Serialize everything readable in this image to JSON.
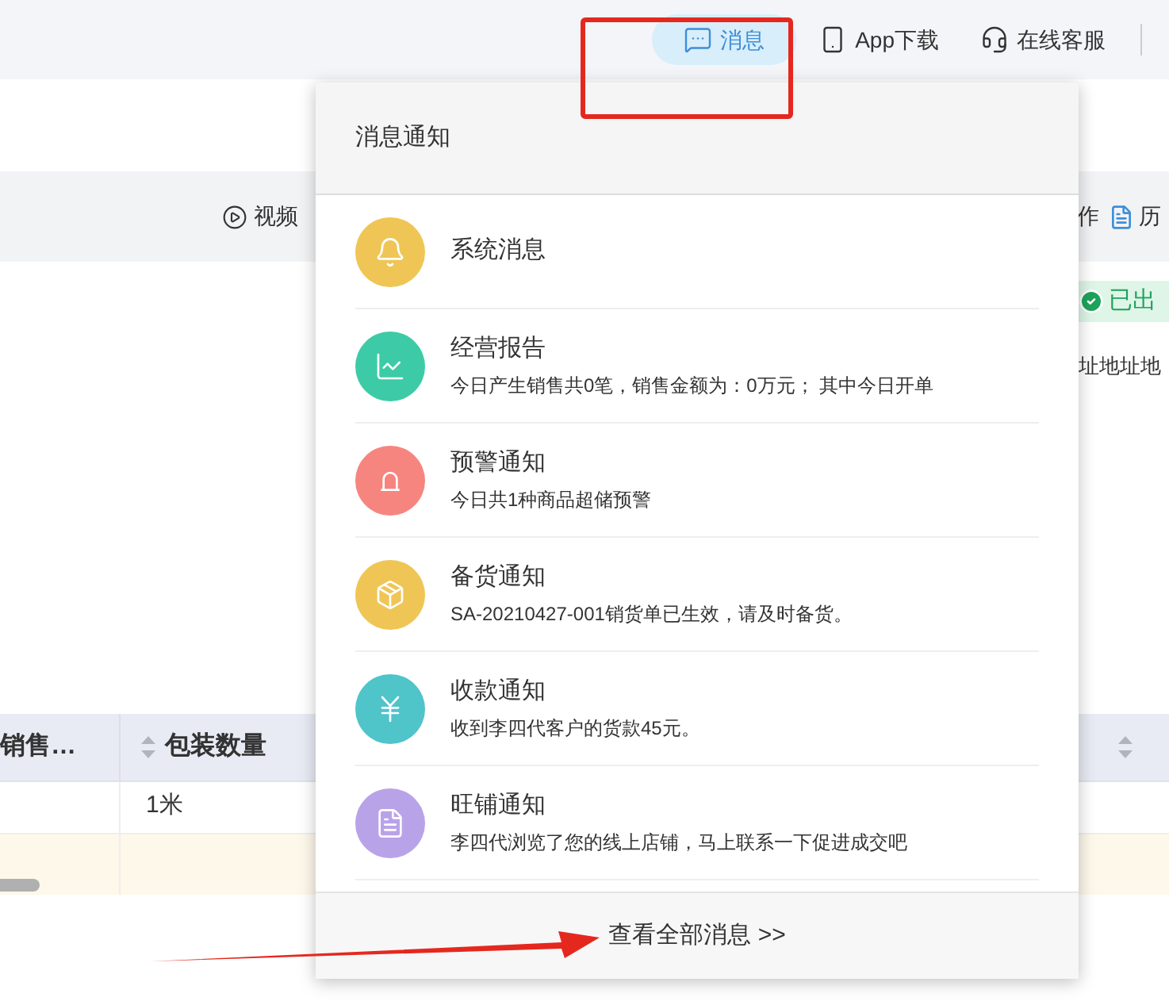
{
  "header": {
    "nav": [
      {
        "label": "消息",
        "selected": true,
        "kind": "message"
      },
      {
        "label": "App下载",
        "selected": false,
        "kind": "phone"
      },
      {
        "label": "在线客服",
        "selected": false,
        "kind": "headset"
      }
    ]
  },
  "toolbar": {
    "video_link": "视频",
    "right_fragment": "作",
    "history_fragment": "历"
  },
  "status_badge": "已出",
  "address_fragment": "址地址地",
  "table": {
    "columns": [
      {
        "label": "销售…",
        "sortable": false
      },
      {
        "label": "包装数量",
        "sortable": true
      }
    ],
    "rows": [
      {
        "packaging_quantity": "1米"
      }
    ]
  },
  "notifications": {
    "title": "消息通知",
    "items": [
      {
        "kind": "bell",
        "color": "#efc655",
        "title": "系统消息"
      },
      {
        "kind": "chart",
        "color": "#3ccba6",
        "title": "经营报告",
        "text": "今日产生销售共0笔，销售金额为：0万元；  其中今日开单"
      },
      {
        "kind": "alarm",
        "color": "#f6857f",
        "title": "预警通知",
        "text": "今日共1种商品超储预警"
      },
      {
        "kind": "box",
        "color": "#efc655",
        "title": "备货通知",
        "text": "SA-20210427-001销货单已生效，请及时备货。"
      },
      {
        "kind": "money",
        "color": "#4fc4c9",
        "title": "收款通知",
        "text": "收到李四代客户的货款45元。"
      },
      {
        "kind": "document",
        "color": "#b9a3e8",
        "title": "旺铺通知",
        "text": "李四代浏览了您的线上店铺，马上联系一下促进成交吧"
      }
    ],
    "footer": "查看全部消息 >>"
  }
}
